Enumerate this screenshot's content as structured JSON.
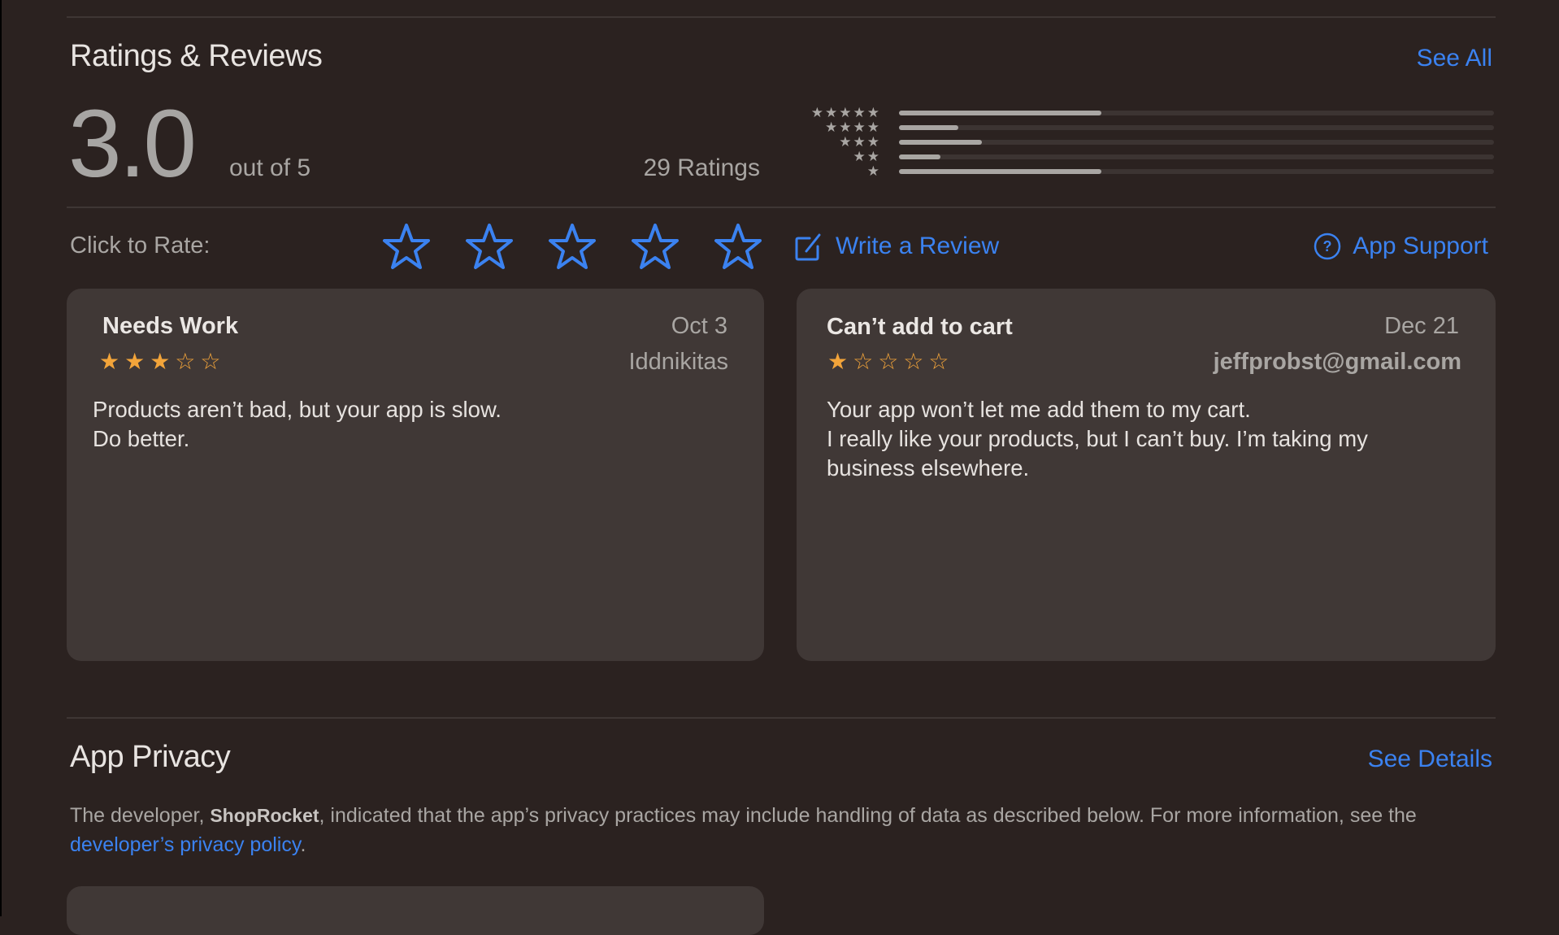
{
  "ratings_reviews": {
    "title": "Ratings & Reviews",
    "see_all": "See All",
    "average": "3.0",
    "out_of": "out of 5",
    "count": "29 Ratings",
    "histogram": [
      {
        "stars": 5,
        "stars_glyph": "★★★★★",
        "fraction": 0.34
      },
      {
        "stars": 4,
        "stars_glyph": "★★★★",
        "fraction": 0.1
      },
      {
        "stars": 3,
        "stars_glyph": "★★★",
        "fraction": 0.14
      },
      {
        "stars": 2,
        "stars_glyph": "★★",
        "fraction": 0.07
      },
      {
        "stars": 1,
        "stars_glyph": "★",
        "fraction": 0.34
      }
    ],
    "click_to_rate": "Click to Rate:",
    "rate_stars": 5,
    "write_review": "Write a Review",
    "app_support": "App Support",
    "accent_color": "#3b82f0",
    "star_color": "#f2a43a"
  },
  "reviews": [
    {
      "title": "Needs Work",
      "date": "Oct 3",
      "author": "Iddnikitas",
      "rating": 3,
      "stars_glyph": "★★★☆☆",
      "body_lines": [
        "Products aren’t bad, but your app is slow.",
        "Do better."
      ]
    },
    {
      "title": "Can’t add to cart",
      "date": "Dec 21",
      "author": "jeffprobst@gmail.com",
      "rating": 1,
      "stars_glyph": "★☆☆☆☆",
      "body_lines": [
        "Your app won’t let me add them to my cart.",
        "I really like your products, but I can’t buy. I’m taking my",
        "business elsewhere."
      ]
    }
  ],
  "app_privacy": {
    "title": "App Privacy",
    "see_details": "See Details",
    "text_before": "The developer, ",
    "developer": "ShopRocket",
    "text_middle": ",  indicated that the app’s privacy practices may include handling of data as described below. For more information, see the ",
    "policy_link": "developer’s privacy policy",
    "text_after": "."
  }
}
